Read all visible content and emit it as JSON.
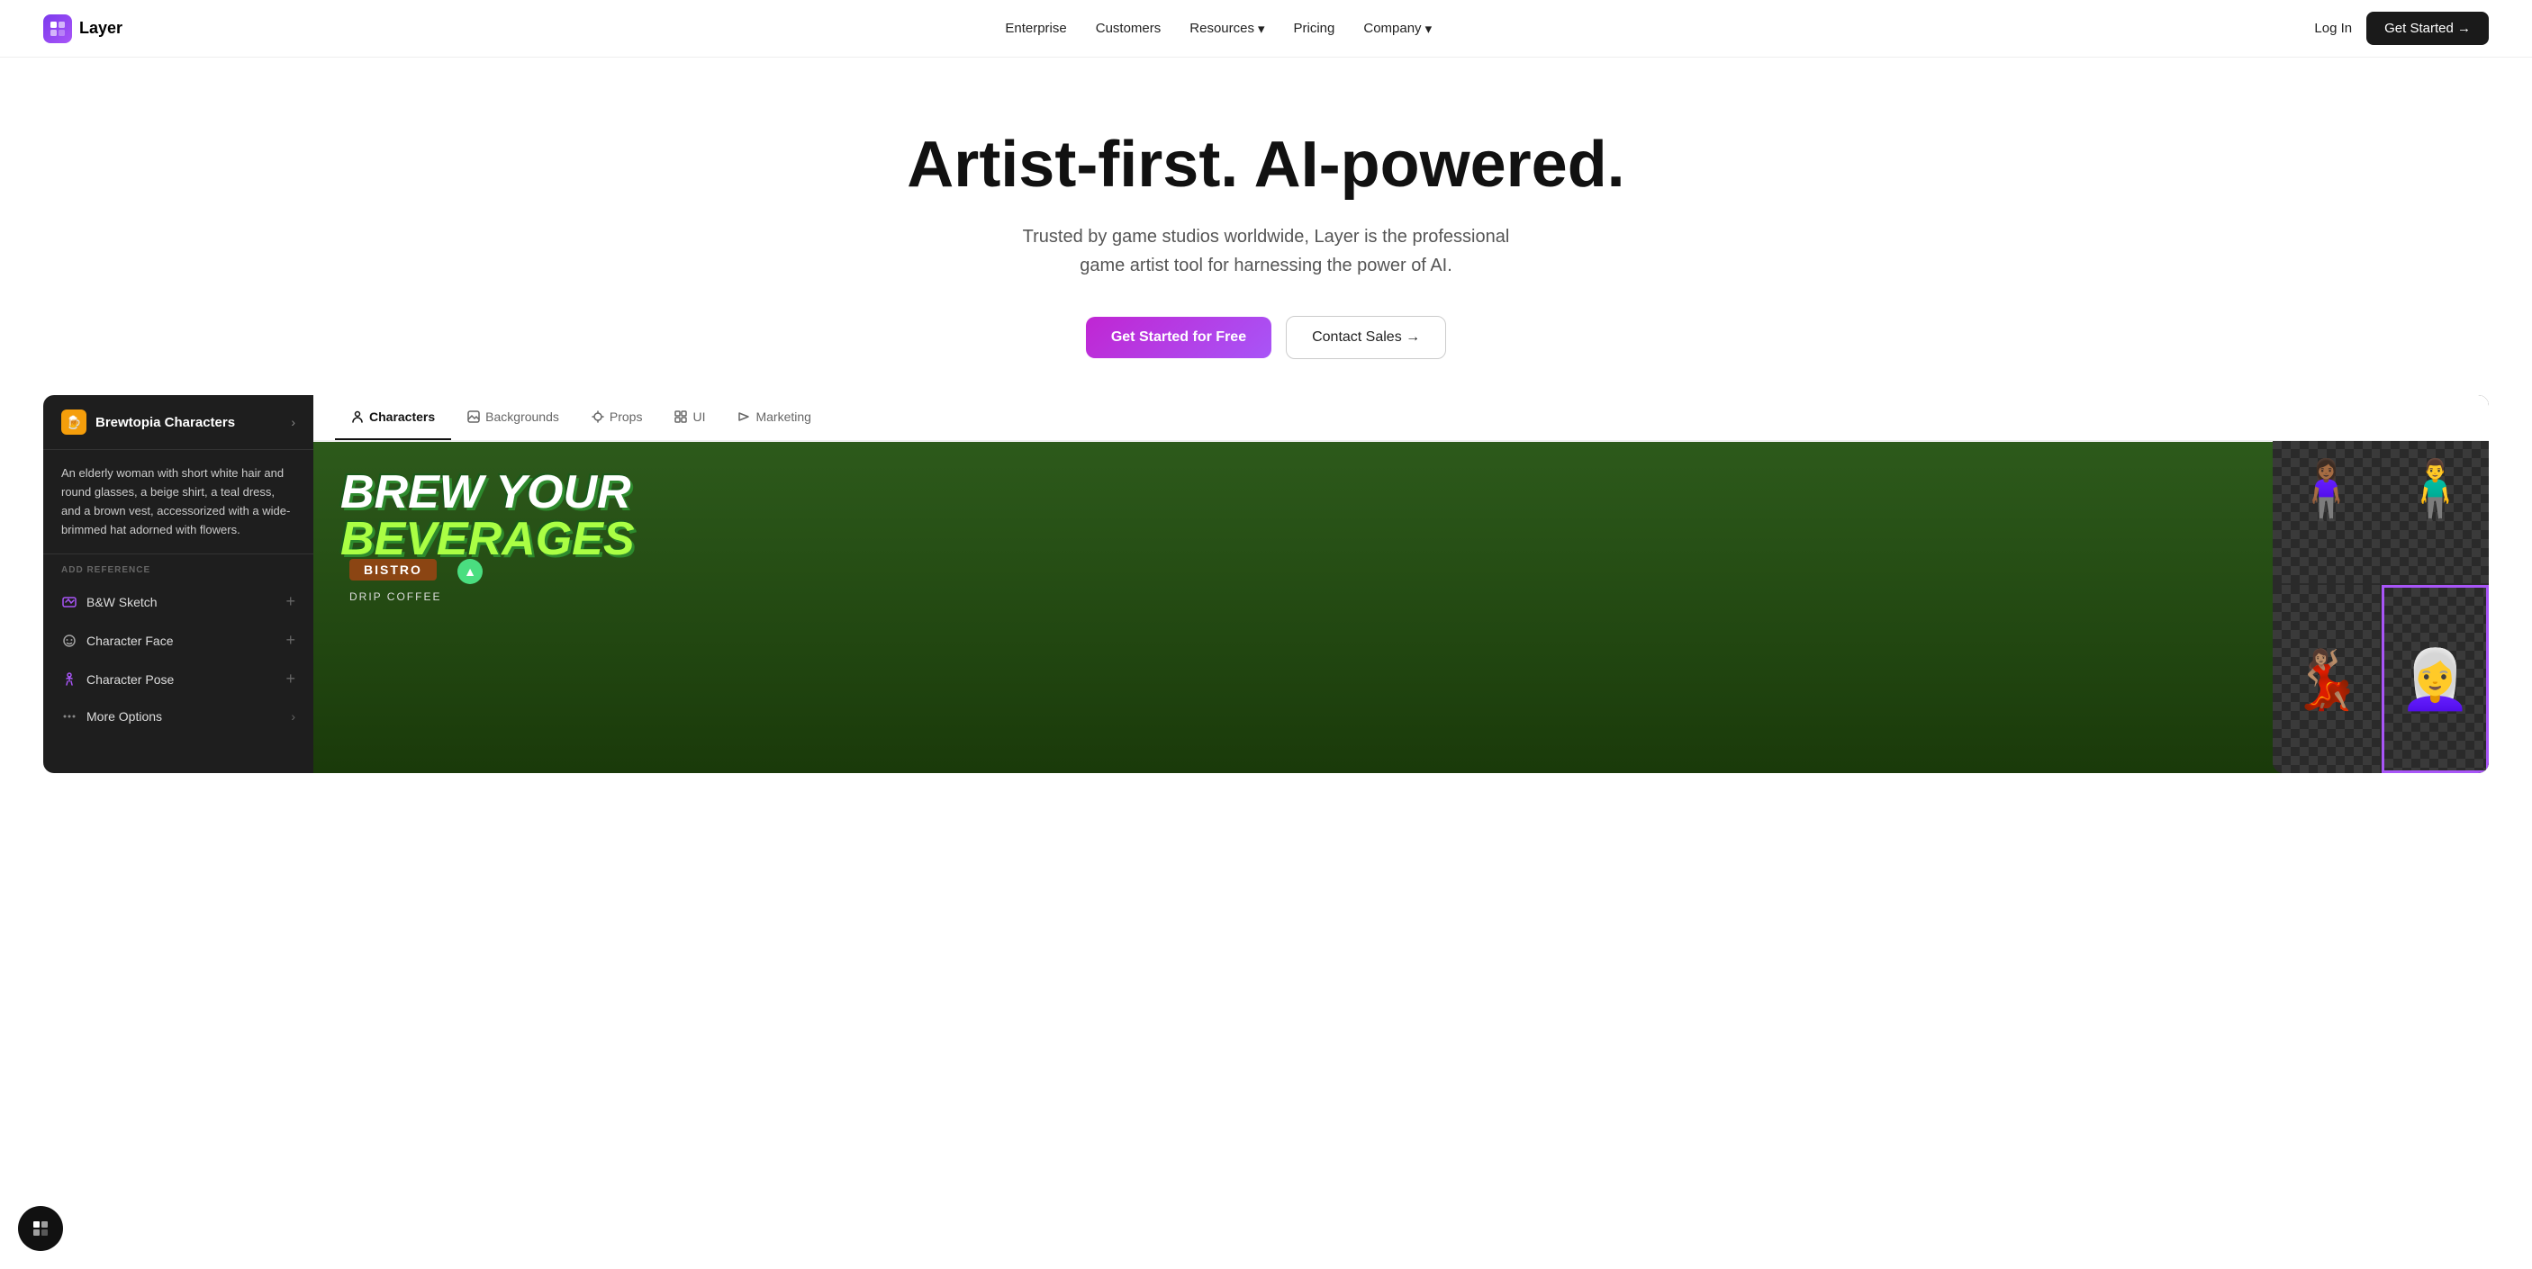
{
  "nav": {
    "logo_text": "Layer",
    "links": [
      {
        "id": "enterprise",
        "label": "Enterprise",
        "has_dropdown": false
      },
      {
        "id": "customers",
        "label": "Customers",
        "has_dropdown": false
      },
      {
        "id": "resources",
        "label": "Resources",
        "has_dropdown": true
      },
      {
        "id": "pricing",
        "label": "Pricing",
        "has_dropdown": false
      },
      {
        "id": "company",
        "label": "Company",
        "has_dropdown": true
      }
    ],
    "login_label": "Log In",
    "get_started_label": "Get Started →"
  },
  "hero": {
    "title": "Artist-first. AI-powered.",
    "subtitle_line1": "Trusted by game studios worldwide, Layer is the professional",
    "subtitle_line2": "game artist tool for harnessing the power of AI.",
    "cta_primary": "Get Started for Free",
    "cta_secondary": "Contact Sales →"
  },
  "sidebar": {
    "project_name": "Brewtopia Characters",
    "description": "An elderly woman with short white hair and round glasses, a beige shirt, a teal dress, and a brown vest, accessorized with a wide-brimmed hat adorned with flowers.",
    "add_reference_label": "ADD REFERENCE",
    "items": [
      {
        "id": "bw-sketch",
        "label": "B&W Sketch",
        "icon": "sketch-icon"
      },
      {
        "id": "character-face",
        "label": "Character Face",
        "icon": "face-icon"
      },
      {
        "id": "character-pose",
        "label": "Character Pose",
        "icon": "pose-icon"
      },
      {
        "id": "more-options",
        "label": "More Options",
        "icon": "more-icon"
      }
    ]
  },
  "tabs": [
    {
      "id": "characters",
      "label": "Characters",
      "active": true
    },
    {
      "id": "backgrounds",
      "label": "Backgrounds",
      "active": false
    },
    {
      "id": "props",
      "label": "Props",
      "active": false
    },
    {
      "id": "ui",
      "label": "UI",
      "active": false
    },
    {
      "id": "marketing",
      "label": "Marketing",
      "active": false
    }
  ],
  "game": {
    "title_line1": "BREW YOUR",
    "title_line2": "BEVERAGES",
    "location_label": "BISTRO",
    "coffee_label": "DRIP COFFEE"
  },
  "characters": [
    {
      "id": "char1",
      "emoji": "🧍🏾‍♀️",
      "description": "Black woman character"
    },
    {
      "id": "char2",
      "emoji": "🧍‍♂️",
      "description": "Man in jacket character"
    },
    {
      "id": "char3",
      "emoji": "💃🏽",
      "description": "Woman in pink character"
    },
    {
      "id": "char4",
      "emoji": "👩‍🦳",
      "description": "Elderly woman character",
      "selected": true
    }
  ],
  "colors": {
    "accent_purple": "#a855f7",
    "accent_pink": "#c026d3",
    "nav_dark": "#1a1a1a",
    "sidebar_bg": "#1e1e1e"
  }
}
